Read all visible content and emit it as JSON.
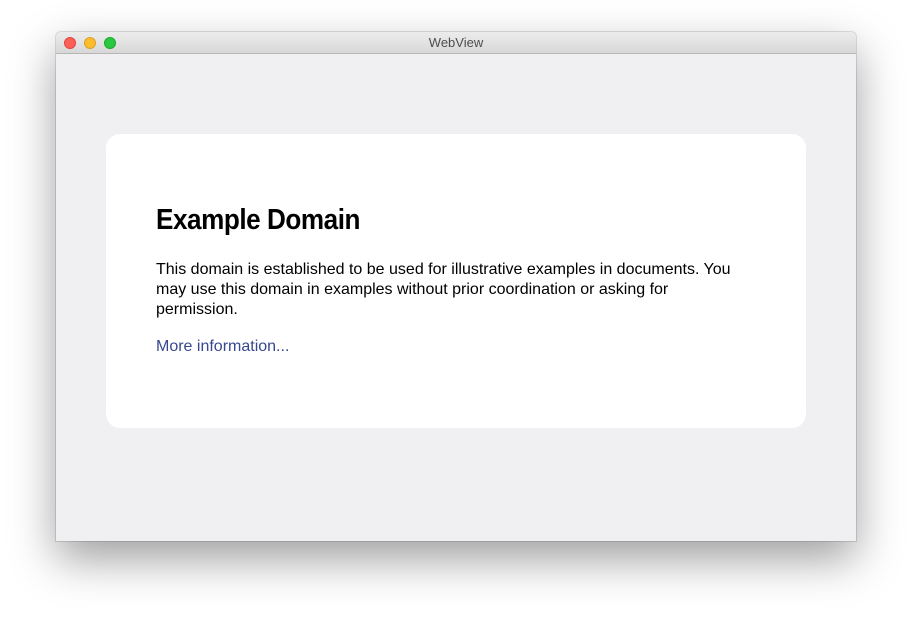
{
  "window": {
    "title": "WebView",
    "controls": [
      "close",
      "minimize",
      "zoom"
    ]
  },
  "page": {
    "heading": "Example Domain",
    "paragraph": "This domain is established to be used for illustrative examples in documents. You may use this domain in examples without prior coordination or asking for permission.",
    "link": "More information..."
  },
  "colors": {
    "background": "#f0f0f2",
    "card": "#ffffff",
    "link": "#38488f",
    "close": "#fc5f57",
    "minimize": "#fdbc2e",
    "zoom": "#28c840"
  }
}
